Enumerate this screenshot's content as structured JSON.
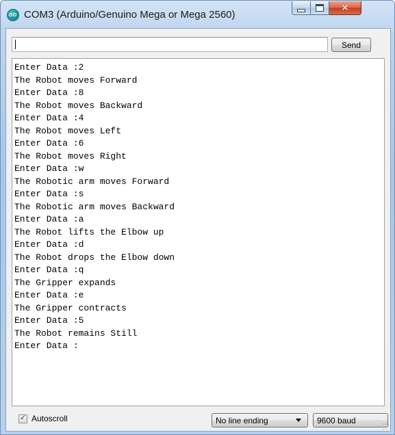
{
  "window": {
    "title": "COM3 (Arduino/Genuino Mega or Mega 2560)",
    "app_icon": "arduino-infinity-icon",
    "controls": {
      "minimize_icon": "minimize-icon",
      "maximize_icon": "maximize-icon",
      "close_icon": "close-icon",
      "close_glyph": "✕"
    },
    "colors": {
      "frame": "#a9c6e7",
      "close_button": "#c5391c",
      "client_background": "#f0f0f0"
    }
  },
  "send_bar": {
    "input_value": "",
    "input_placeholder": "",
    "send_label": "Send"
  },
  "serial_output": {
    "lines": [
      "Enter Data :2",
      "The Robot moves Forward",
      "Enter Data :8",
      "The Robot moves Backward",
      "Enter Data :4",
      "The Robot moves Left",
      "Enter Data :6",
      "The Robot moves Right",
      "Enter Data :w",
      "The Robotic arm moves Forward",
      "Enter Data :s",
      "The Robotic arm moves Backward",
      "Enter Data :a",
      "The Robot lifts the Elbow up",
      "Enter Data :d",
      "The Robot drops the Elbow down",
      "Enter Data :q",
      "The Gripper expands",
      "Enter Data :e",
      "The Gripper contracts",
      "Enter Data :5",
      "The Robot remains Still",
      "Enter Data :"
    ]
  },
  "footer": {
    "autoscroll_label": "Autoscroll",
    "autoscroll_checked": true,
    "line_ending_selected": "No line ending",
    "baud_selected": "9600 baud"
  }
}
